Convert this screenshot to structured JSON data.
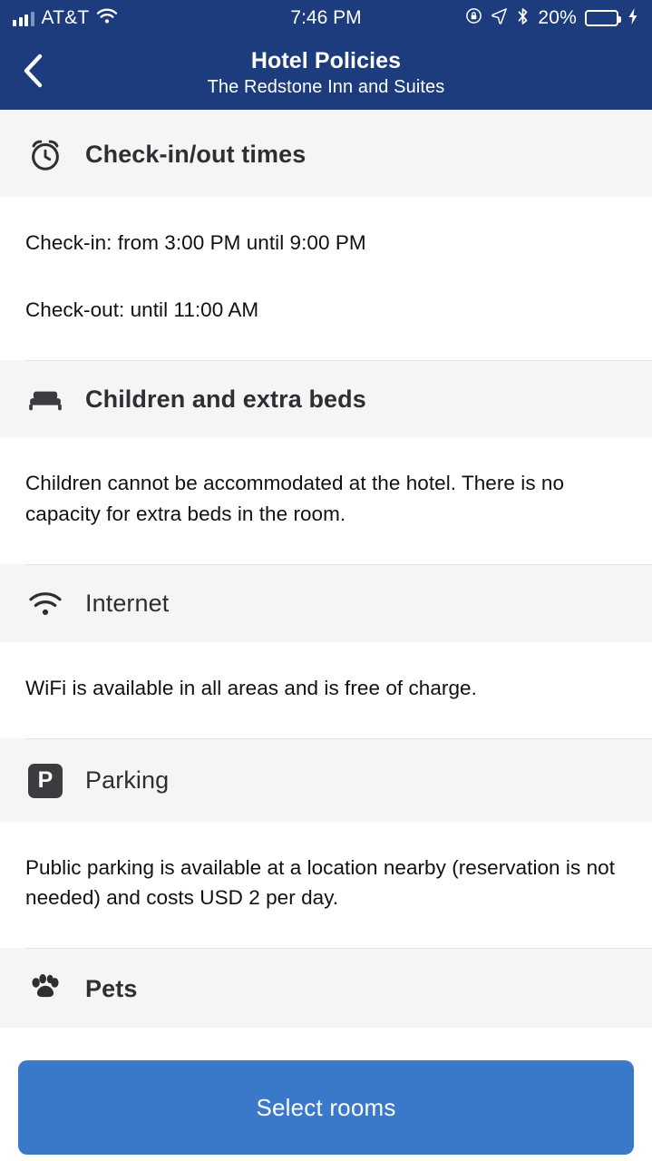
{
  "status_bar": {
    "carrier": "AT&T",
    "time": "7:46 PM",
    "battery_percent": "20%",
    "battery_level": 20,
    "icons": [
      "signal-bars-icon",
      "wifi-icon",
      "rotation-lock-icon",
      "location-arrow-icon",
      "bluetooth-icon",
      "battery-icon",
      "charging-bolt-icon"
    ],
    "colors": {
      "bar_bg": "#1c3c7d",
      "battery_fill": "#ef3124"
    }
  },
  "nav": {
    "back_icon": "chevron-left-icon",
    "title": "Hotel Policies",
    "subtitle": "The Redstone Inn and Suites"
  },
  "sections": [
    {
      "id": "check-in-out-times",
      "icon": "alarm-clock-icon",
      "title": "Check-in/out times",
      "title_weight": "bold",
      "lines": [
        "Check-in: from 3:00 PM until 9:00 PM",
        "Check-out: until 11:00 AM"
      ]
    },
    {
      "id": "children-and-extra-beds",
      "icon": "bed-icon",
      "title": "Children and extra beds",
      "title_weight": "bold",
      "lines": [
        "Children cannot be accommodated at the hotel. There is no capacity for extra beds in the room."
      ]
    },
    {
      "id": "internet",
      "icon": "wifi-icon",
      "title": "Internet",
      "title_weight": "regular",
      "lines": [
        "WiFi is available in all areas and is free of charge."
      ]
    },
    {
      "id": "parking",
      "icon": "parking-p-icon",
      "title": "Parking",
      "title_weight": "regular",
      "lines": [
        "Public parking is available at a location nearby (reservation is not needed) and costs USD 2 per day."
      ]
    },
    {
      "id": "pets",
      "icon": "paw-print-icon",
      "title": "Pets",
      "title_weight": "bold",
      "lines": []
    }
  ],
  "cta": {
    "label": "Select rooms",
    "color": "#3a78c9"
  }
}
